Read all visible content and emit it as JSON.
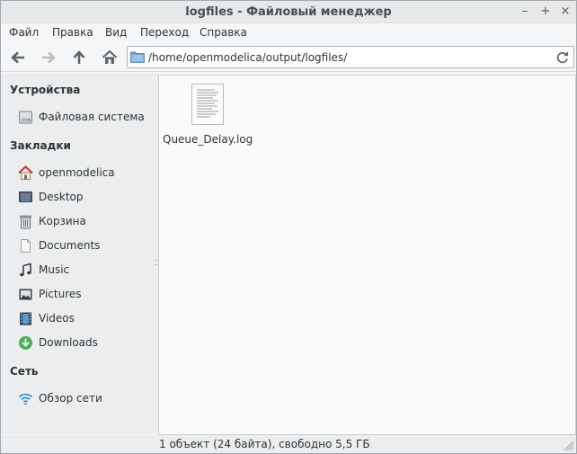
{
  "window": {
    "title": "logfiles - Файловый менеджер",
    "controls": {
      "minimize": "–",
      "maximize": "+",
      "close": "×"
    }
  },
  "menubar": {
    "items": [
      {
        "label": "Файл"
      },
      {
        "label": "Правка"
      },
      {
        "label": "Вид"
      },
      {
        "label": "Переход"
      },
      {
        "label": "Справка"
      }
    ]
  },
  "toolbar": {
    "buttons": [
      {
        "icon": "arrow-left-icon"
      },
      {
        "icon": "arrow-right-icon"
      },
      {
        "icon": "arrow-up-icon"
      },
      {
        "icon": "home-icon"
      }
    ],
    "path": "/home/openmodelica/output/logfiles/"
  },
  "sidebar": {
    "devices_header": "Устройства",
    "devices": [
      {
        "label": "Файловая система",
        "icon": "drive-icon"
      }
    ],
    "bookmarks_header": "Закладки",
    "bookmarks": [
      {
        "label": "openmodelica",
        "icon": "home-icon"
      },
      {
        "label": "Desktop",
        "icon": "desktop-icon"
      },
      {
        "label": "Корзина",
        "icon": "trash-icon"
      },
      {
        "label": "Documents",
        "icon": "document-icon"
      },
      {
        "label": "Music",
        "icon": "music-icon"
      },
      {
        "label": "Pictures",
        "icon": "pictures-icon"
      },
      {
        "label": "Videos",
        "icon": "video-icon"
      },
      {
        "label": "Downloads",
        "icon": "download-icon"
      }
    ],
    "network_header": "Сеть",
    "network": [
      {
        "label": "Обзор сети",
        "icon": "wifi-icon"
      }
    ]
  },
  "files": [
    {
      "name": "Queue_Delay.log",
      "icon": "text-file-icon"
    }
  ],
  "status": {
    "text": "1 объект (24 байта), свободно 5,5 ГБ"
  },
  "colors": {
    "accent": "#4a90d9",
    "home_icon": "#c0392b",
    "download_icon": "#4caf50",
    "wifi_icon": "#3f8fd8"
  }
}
